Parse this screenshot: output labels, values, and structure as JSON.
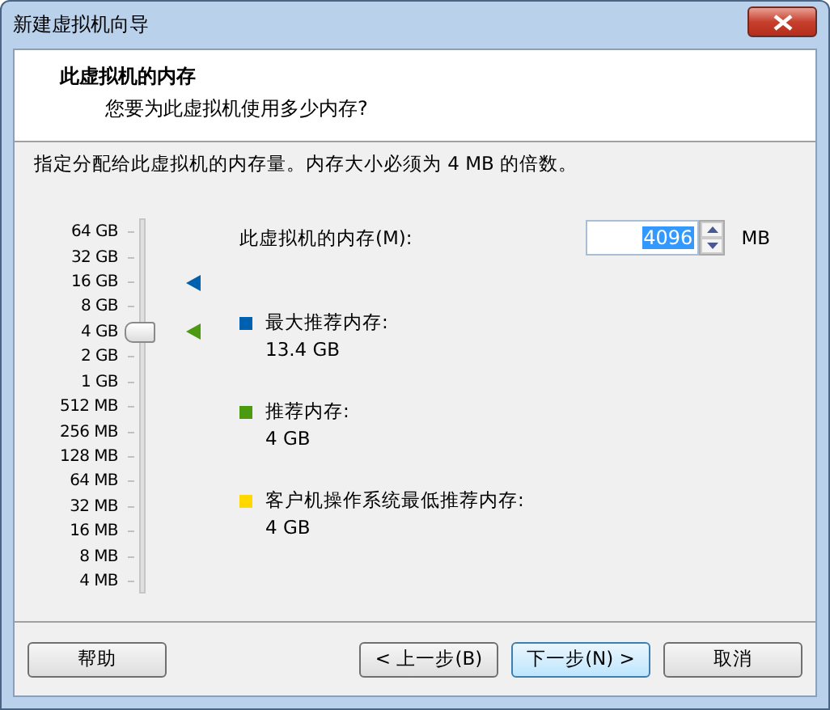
{
  "window": {
    "title": "新建虚拟机向导"
  },
  "header": {
    "title": "此虚拟机的内存",
    "subtitle": "您要为此虚拟机使用多少内存?"
  },
  "description": "指定分配给此虚拟机的内存量。内存大小必须为 4 MB 的倍数。",
  "slider": {
    "level": 0.714,
    "ticks": [
      {
        "label": "64 GB"
      },
      {
        "label": "32 GB"
      },
      {
        "label": "16 GB",
        "color": "#0060b0"
      },
      {
        "label": "8 GB"
      },
      {
        "label": "4 GB",
        "color": "#4c9a10"
      },
      {
        "label": "2 GB"
      },
      {
        "label": "1 GB"
      },
      {
        "label": "512 MB"
      },
      {
        "label": "256 MB"
      },
      {
        "label": "128 MB"
      },
      {
        "label": "64 MB"
      },
      {
        "label": "32 MB"
      },
      {
        "label": "16 MB"
      },
      {
        "label": "8 MB"
      },
      {
        "label": "4 MB"
      }
    ]
  },
  "memory": {
    "label": "此虚拟机的内存(M):",
    "value": "4096",
    "unit": "MB"
  },
  "legend": [
    {
      "label": "最大推荐内存:",
      "value": "13.4 GB",
      "color": "#0060b0"
    },
    {
      "label": "推荐内存:",
      "value": "4 GB",
      "color": "#4c9a10"
    },
    {
      "label": "客户机操作系统最低推荐内存:",
      "value": "4 GB",
      "color": "#ffd800"
    }
  ],
  "buttons": [
    {
      "label": "帮助",
      "kind": "plain"
    },
    {
      "label": "< 上一步(B)",
      "kind": "plain"
    },
    {
      "label": "下一步(N) >",
      "kind": "default"
    },
    {
      "label": "取消",
      "kind": "plain"
    }
  ]
}
